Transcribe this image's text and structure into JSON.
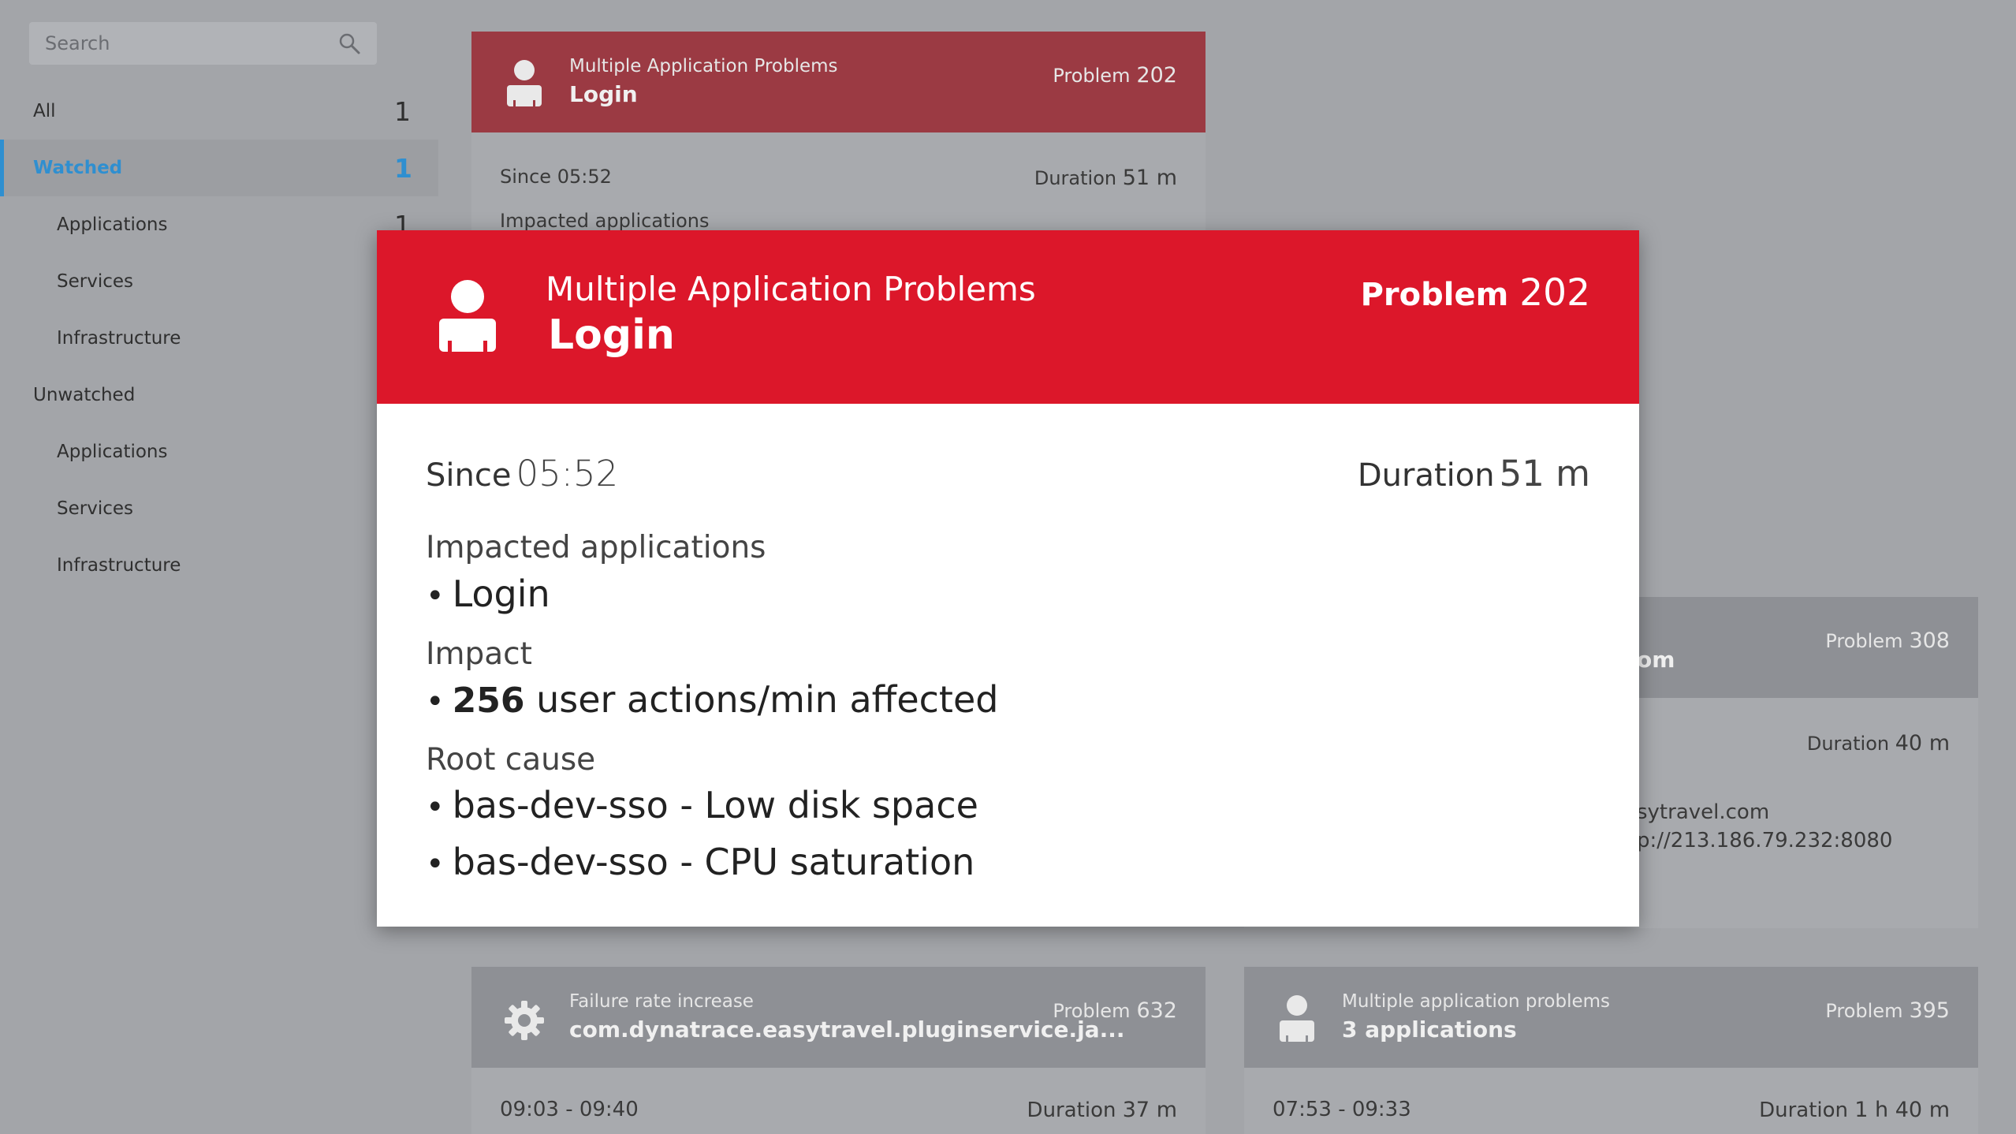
{
  "sidebar": {
    "search_placeholder": "Search",
    "items": [
      {
        "label": "All",
        "count": "1"
      },
      {
        "label": "Watched",
        "count": "1"
      },
      {
        "label": "Applications",
        "count": "1"
      },
      {
        "label": "Services"
      },
      {
        "label": "Infrastructure"
      },
      {
        "label": "Unwatched"
      },
      {
        "label": "Applications"
      },
      {
        "label": "Services"
      },
      {
        "label": "Infrastructure"
      }
    ]
  },
  "cards": {
    "c1": {
      "subtitle": "Multiple Application Problems",
      "title": "Login",
      "problem_label": "Problem",
      "problem_number": "202",
      "since_label": "Since",
      "since_value": "05:52",
      "duration_label": "Duration",
      "duration_value": "51 m",
      "impacted_label": "Impacted applications"
    },
    "c2": {
      "title_fragment": "om",
      "problem_label": "Problem",
      "problem_number": "308",
      "duration_label": "Duration",
      "duration_value": "40 m",
      "line1": "sytravel.com",
      "line2": "p://213.186.79.232:8080"
    },
    "c3": {
      "subtitle": "Failure rate increase",
      "title": "com.dynatrace.easytravel.pluginservice.ja...",
      "problem_label": "Problem",
      "problem_number": "632",
      "time_range": "09:03 - 09:40",
      "duration_label": "Duration",
      "duration_value": "37 m"
    },
    "c4": {
      "subtitle": "Multiple application problems",
      "title": "3 applications",
      "problem_label": "Problem",
      "problem_number": "395",
      "time_range": "07:53 - 09:33",
      "duration_label": "Duration",
      "duration_value": "1 h 40 m"
    }
  },
  "modal": {
    "subtitle": "Multiple Application Problems",
    "title": "Login",
    "problem_label": "Problem",
    "problem_number": "202",
    "since_label": "Since",
    "since_value": "05:52",
    "duration_label": "Duration",
    "duration_value": "51 m",
    "impacted_heading": "Impacted applications",
    "impacted_items": [
      "Login"
    ],
    "impact_heading": "Impact",
    "impact_number": "256",
    "impact_text": "user actions/min affected",
    "root_cause_heading": "Root cause",
    "root_causes": [
      "bas-dev-sso - Low disk space",
      "bas-dev-sso - CPU saturation"
    ],
    "bullet": "•"
  },
  "colors": {
    "modal_header": "#dc172a",
    "accent_blue": "#2f8fd0",
    "background": "#a3a5a9"
  },
  "icons": {
    "search": "search-icon",
    "user": "user-icon",
    "gear": "gear-icon"
  }
}
